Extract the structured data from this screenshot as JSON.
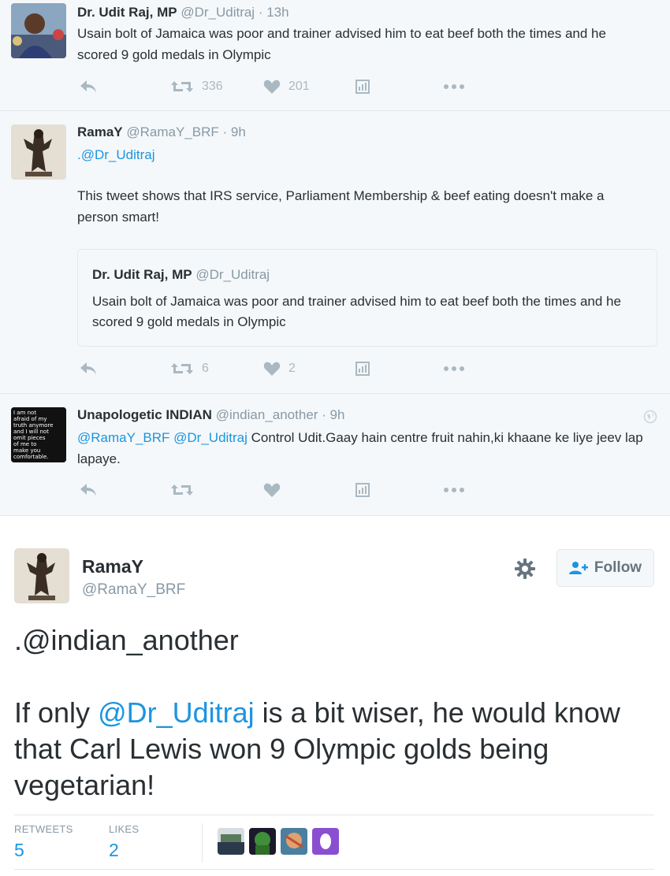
{
  "tweets": [
    {
      "name": "Dr. Udit Raj, MP",
      "handle": "@Dr_Uditraj",
      "time": "· 13h",
      "text": "Usain bolt of Jamaica was poor and trainer advised him  to eat beef both the times and he scored 9 gold medals in Olympic",
      "retweets": "336",
      "likes": "201"
    },
    {
      "name": "RamaY",
      "handle": "@RamaY_BRF",
      "time": "· 9h",
      "mention": ".@Dr_Uditraj",
      "text": "This tweet shows that IRS service, Parliament Membership  & beef eating doesn't make a person smart!",
      "quote": {
        "name": "Dr. Udit Raj, MP",
        "handle": "@Dr_Uditraj",
        "text": "Usain bolt of Jamaica was poor and trainer advised him  to eat beef both the times and he scored 9 gold medals in Olympic"
      },
      "retweets": "6",
      "likes": "2"
    },
    {
      "name": "Unapologetic INDIAN",
      "handle": "@indian_another",
      "time": "· 9h",
      "mention1": "@RamaY_BRF",
      "mention2": "@Dr_Uditraj",
      "text": " Control Udit.Gaay hain centre fruit nahin,ki khaane ke liye jeev lap lapaye.",
      "avatar_text": "I am not afraid of my truth anymore and I will not omit pieces of me to make you comfortable"
    }
  ],
  "main": {
    "name": "RamaY",
    "handle": "@RamaY_BRF",
    "follow_label": "Follow",
    "mention": ".@indian_another",
    "text_pre": "If only ",
    "text_mention": "@Dr_Uditraj",
    "text_post": " is a bit wiser, he would know that Carl Lewis won 9 Olympic golds being vegetarian!",
    "retweets_label": "RETWEETS",
    "retweets_value": "5",
    "likes_label": "LIKES",
    "likes_value": "2"
  },
  "colors": {
    "link": "#1b95e0",
    "icon": "#aab8c2",
    "meta": "#8899a6"
  }
}
